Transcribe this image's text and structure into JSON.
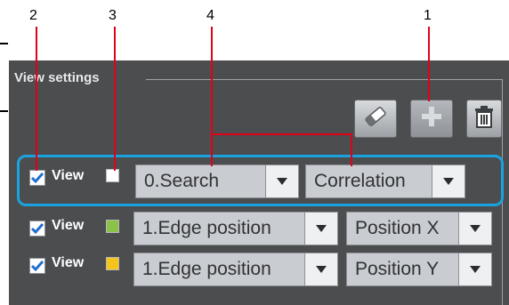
{
  "callouts": {
    "n1": "1",
    "n2": "2",
    "n3": "3",
    "n4": "4",
    "line_color": "#e2001a"
  },
  "panel": {
    "group_title": "View settings",
    "background": "#4b4d4f"
  },
  "toolbar": {
    "buttons": [
      {
        "icon": "eraser-icon",
        "enabled": true
      },
      {
        "icon": "plus-icon",
        "enabled": false
      },
      {
        "icon": "trash-icon",
        "enabled": true
      }
    ]
  },
  "rows": [
    {
      "view_checked": true,
      "view_label": "View",
      "color": "#ffffff",
      "item": "0.Search",
      "measure": "Correlation",
      "selected": true
    },
    {
      "view_checked": true,
      "view_label": "View",
      "color": "#8bc34a",
      "item": "1.Edge position",
      "measure": "Position X",
      "selected": false
    },
    {
      "view_checked": true,
      "view_label": "View",
      "color": "#f5c51c",
      "item": "1.Edge position",
      "measure": "Position Y",
      "selected": false
    }
  ],
  "accent": "#1aa3e0"
}
